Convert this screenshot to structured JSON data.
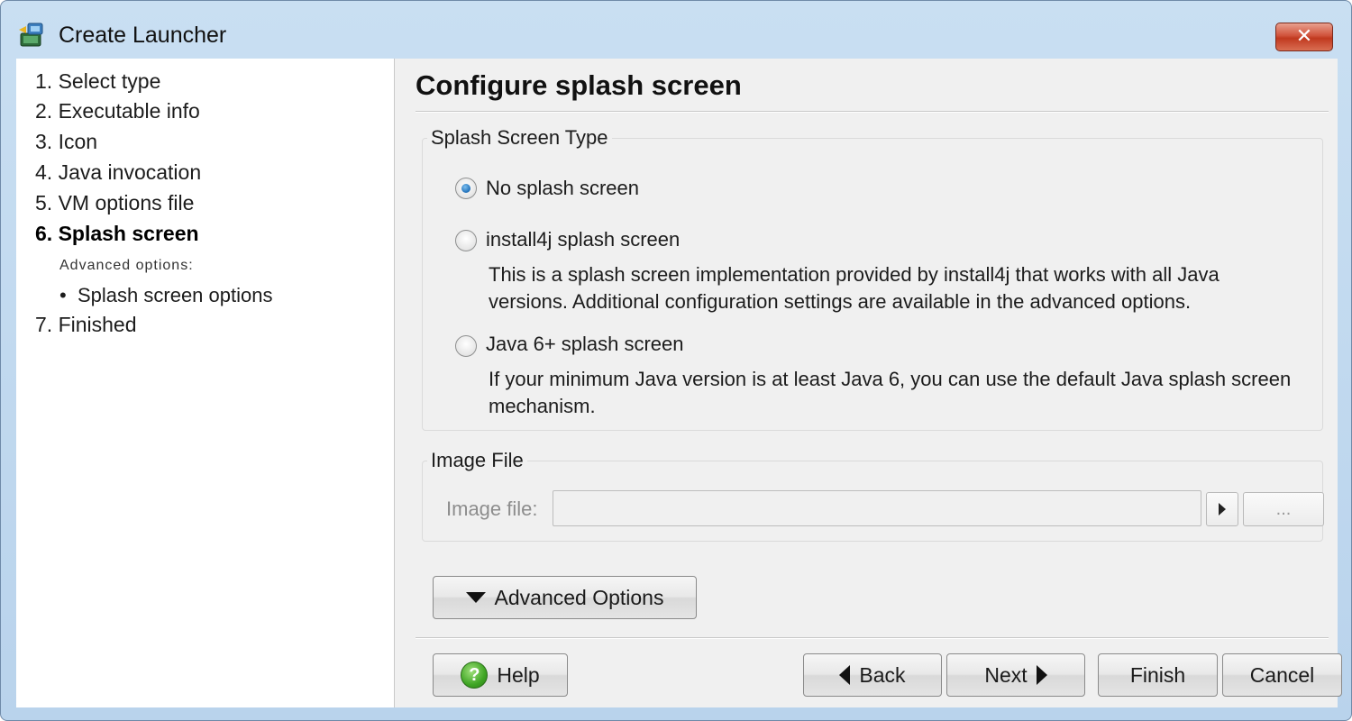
{
  "window": {
    "title": "Create Launcher",
    "close_symbol": "✕"
  },
  "sidebar": {
    "steps": [
      {
        "label": "1. Select type"
      },
      {
        "label": "2. Executable info"
      },
      {
        "label": "3. Icon"
      },
      {
        "label": "4. Java invocation"
      },
      {
        "label": "5. VM options file"
      },
      {
        "label": "6. Splash screen",
        "active": true
      },
      {
        "label": "7. Finished"
      }
    ],
    "advanced_label": "Advanced options:",
    "sub_items": [
      {
        "label": "Splash screen options",
        "bullet": "•"
      }
    ]
  },
  "main": {
    "title": "Configure splash screen",
    "splash_group": {
      "label": "Splash Screen Type",
      "options": [
        {
          "label": "No splash screen",
          "checked": true
        },
        {
          "label": "install4j splash screen",
          "checked": false,
          "description": "This is a splash screen implementation provided by install4j that works with all Java versions. Additional configuration settings are available in the advanced options."
        },
        {
          "label": "Java 6+ splash screen",
          "checked": false,
          "description": "If your minimum Java version is at least Java 6, you can use the default Java splash screen mechanism."
        }
      ]
    },
    "image_group": {
      "label": "Image File",
      "field_label": "Image file:",
      "field_value": "",
      "browse_label": "..."
    },
    "advanced_button": "Advanced Options"
  },
  "footer": {
    "help": "Help",
    "help_symbol": "?",
    "back": "Back",
    "next": "Next",
    "finish": "Finish",
    "cancel": "Cancel"
  },
  "colors": {
    "titlebar": "#c9dff2",
    "client_bg": "#f0f0f0",
    "close_button": "#c0391f",
    "radio_selected": "#1f6fb8",
    "help_icon": "#3fa524"
  },
  "icons": [
    "launcher-app-icon",
    "close-icon",
    "radio-icon",
    "arrow-right-icon",
    "chevron-down-icon",
    "help-icon",
    "arrow-left-icon"
  ]
}
